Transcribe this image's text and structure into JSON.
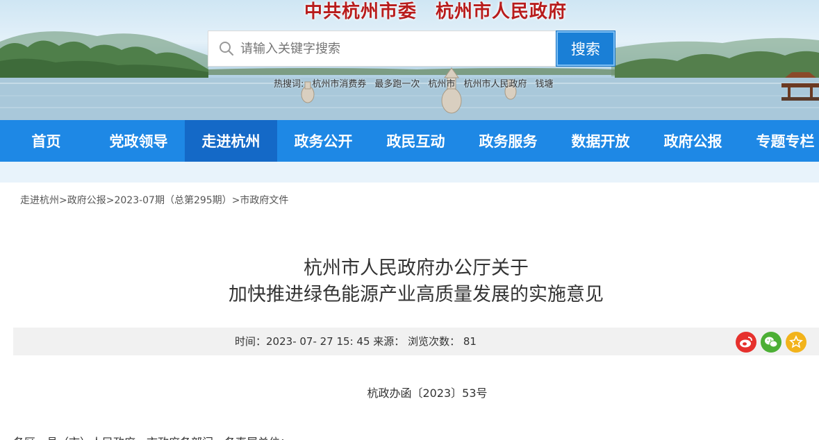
{
  "header": {
    "site_title": "中共杭州市委　杭州市人民政府",
    "search_placeholder": "请输入关键字搜索",
    "search_button": "搜索",
    "hot_words": [
      "热搜词:",
      "杭州市消费券",
      "最多跑一次",
      "杭州市",
      "杭州市人民政府",
      "钱塘"
    ]
  },
  "nav": {
    "items": [
      "首页",
      "党政领导",
      "走进杭州",
      "政务公开",
      "政民互动",
      "政务服务",
      "数据开放",
      "政府公报",
      "专题专栏"
    ],
    "active": "走进杭州"
  },
  "breadcrumb": {
    "items": [
      "走进杭州",
      "政府公报",
      "2023-07期（总第295期）",
      "市政府文件"
    ],
    "separator": ">"
  },
  "article": {
    "title_line1": "杭州市人民政府办公厅关于",
    "title_line2": "加快推进绿色能源产业高质量发展的实施意见",
    "meta_time_label": "时间：",
    "meta_time": "2023- 07- 27 15: 45",
    "meta_source_label": "来源：",
    "meta_views_label": "浏览次数：",
    "meta_views": "81",
    "doc_number": "杭政办函〔2023〕53号",
    "salutation": "各区、县（市）人民政府，市政府各部门、各直属单位："
  },
  "share": {
    "icons": [
      "weibo-icon",
      "wechat-icon",
      "favorite-icon"
    ],
    "colors": {
      "weibo": "#e6312d",
      "wechat": "#4caf35",
      "favorite": "#f2b31b"
    }
  },
  "colors": {
    "nav_bg": "#1e88e5",
    "nav_active": "#1469c7",
    "title_red": "#b81c1c",
    "search_btn": "#1a7fd6"
  }
}
